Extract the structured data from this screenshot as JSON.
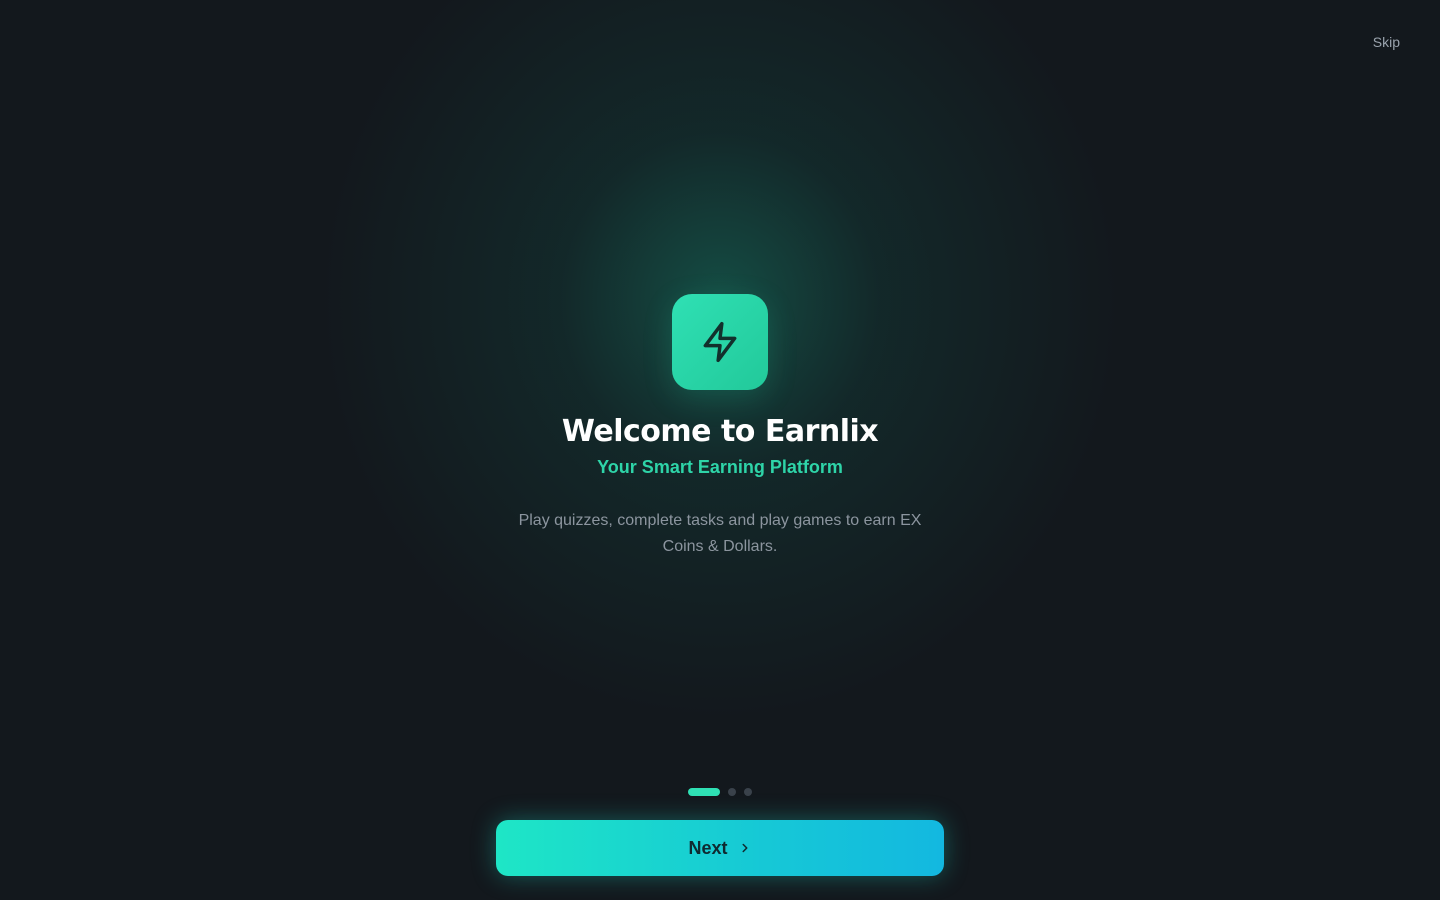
{
  "header": {
    "skip_label": "Skip"
  },
  "hero": {
    "logo_icon": "lightning-bolt-icon",
    "title": "Welcome to Earnlix",
    "subtitle": "Your Smart Earning Platform",
    "description": "Play quizzes, complete tasks and play games to earn EX Coins & Dollars."
  },
  "pagination": {
    "total": 3,
    "active_index": 0
  },
  "footer": {
    "next_label": "Next",
    "next_icon": "chevron-right-icon"
  },
  "colors": {
    "background": "#13181d",
    "accent": "#2fe0b4",
    "subtitle": "#2ed4a8",
    "button_gradient_start": "#1ee6c6",
    "button_gradient_end": "#13b8e0"
  }
}
